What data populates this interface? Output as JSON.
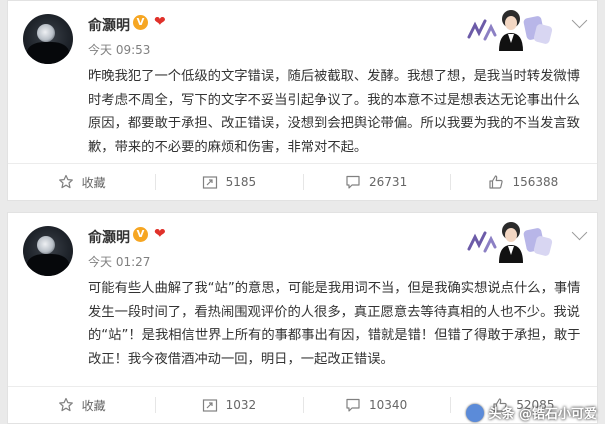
{
  "posts": [
    {
      "username": "俞灏明",
      "verified_badge": "V",
      "badge_color": "#f6a623",
      "heart": "❤",
      "timestamp": "今天 09:53",
      "content": "昨晚我犯了一个低级的文字错误，随后被截取、发酵。我想了想，是我当时转发微博时考虑不周全，写下的文字不妥当引起争议了。我的本意不过是想表达无论事出什么原因，都要敢于承担、改正错误，没想到会把舆论带偏。所以我要为我的不当发言致歉，带来的不必要的麻烦和伤害，非常对不起。",
      "actions": {
        "favorite_label": "收藏",
        "repost_count": "5185",
        "comment_count": "26731",
        "like_count": "156388"
      }
    },
    {
      "username": "俞灏明",
      "verified_badge": "V",
      "badge_color": "#f6a623",
      "heart": "❤",
      "timestamp": "今天 01:27",
      "content": "可能有些人曲解了我“站”的意思，可能是我用词不当，但是我确实想说点什么，事情发生一段时间了，看热闹围观评价的人很多，真正愿意去等待真相的人也不少。我说的“站”！是我相信世界上所有的事都事出有因，错就是错！但错了得敢于承担，敢于改正！我今夜借酒冲动一回，明日，一起改正错误。",
      "actions": {
        "favorite_label": "收藏",
        "repost_count": "1032",
        "comment_count": "10340",
        "like_count": "52085"
      }
    }
  ],
  "watermark": "头条 @锆石小可爱",
  "icons": [
    "avatar",
    "verified-badge",
    "heart-icon",
    "decoration-illustration",
    "chevron-down-icon",
    "star-icon",
    "repost-icon",
    "comment-icon",
    "like-icon"
  ]
}
